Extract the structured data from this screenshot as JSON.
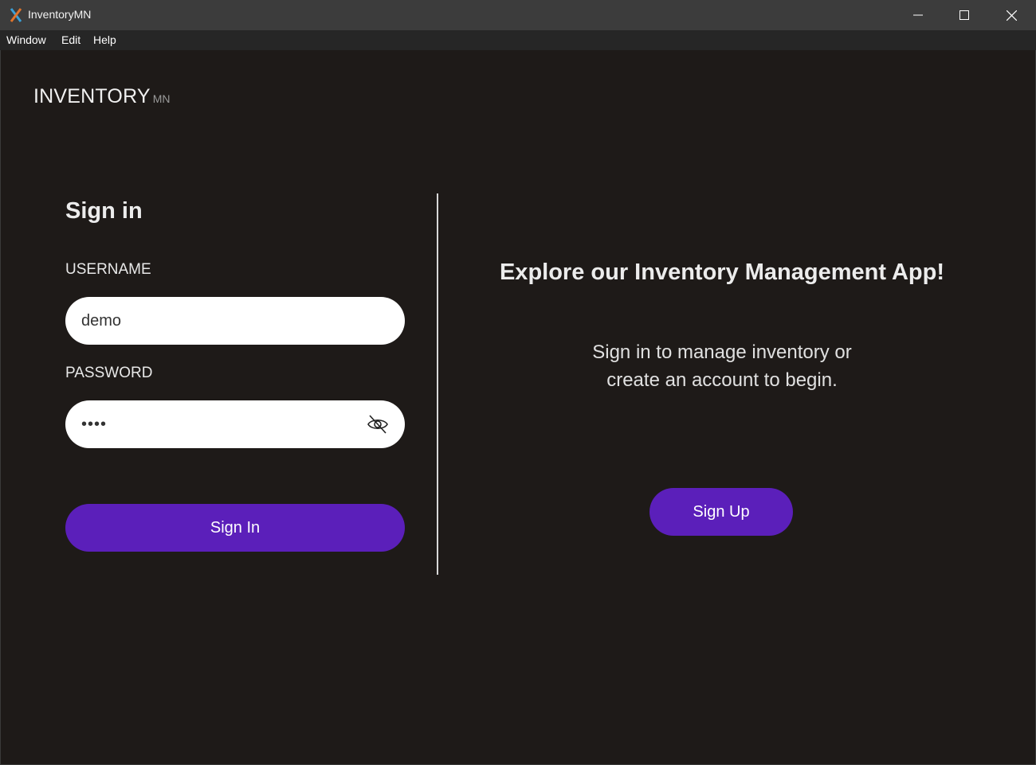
{
  "window": {
    "title": "InventoryMN",
    "controls": [
      "minimize-icon",
      "maximize-icon",
      "close-icon"
    ]
  },
  "menu": {
    "items": [
      {
        "label": "Window"
      },
      {
        "label": "Edit"
      },
      {
        "label": "Help"
      }
    ]
  },
  "logo": {
    "main": "INVENTORY",
    "sub": "MN"
  },
  "signin": {
    "title": "Sign in",
    "username_label": "USERNAME",
    "username_value": "demo",
    "password_label": "PASSWORD",
    "password_value": "••••",
    "password_visibility_icon": "eye-slash-icon",
    "button_label": "Sign In"
  },
  "explore": {
    "title": "Explore our Inventory Management App!",
    "line1": "Sign in to manage inventory or",
    "line2": "create an account to begin.",
    "signup_label": "Sign Up"
  },
  "colors": {
    "background": "#1e1a18",
    "titlebar": "#3c3c3c",
    "accent": "#5b1fba",
    "input_bg": "#ffffff"
  }
}
